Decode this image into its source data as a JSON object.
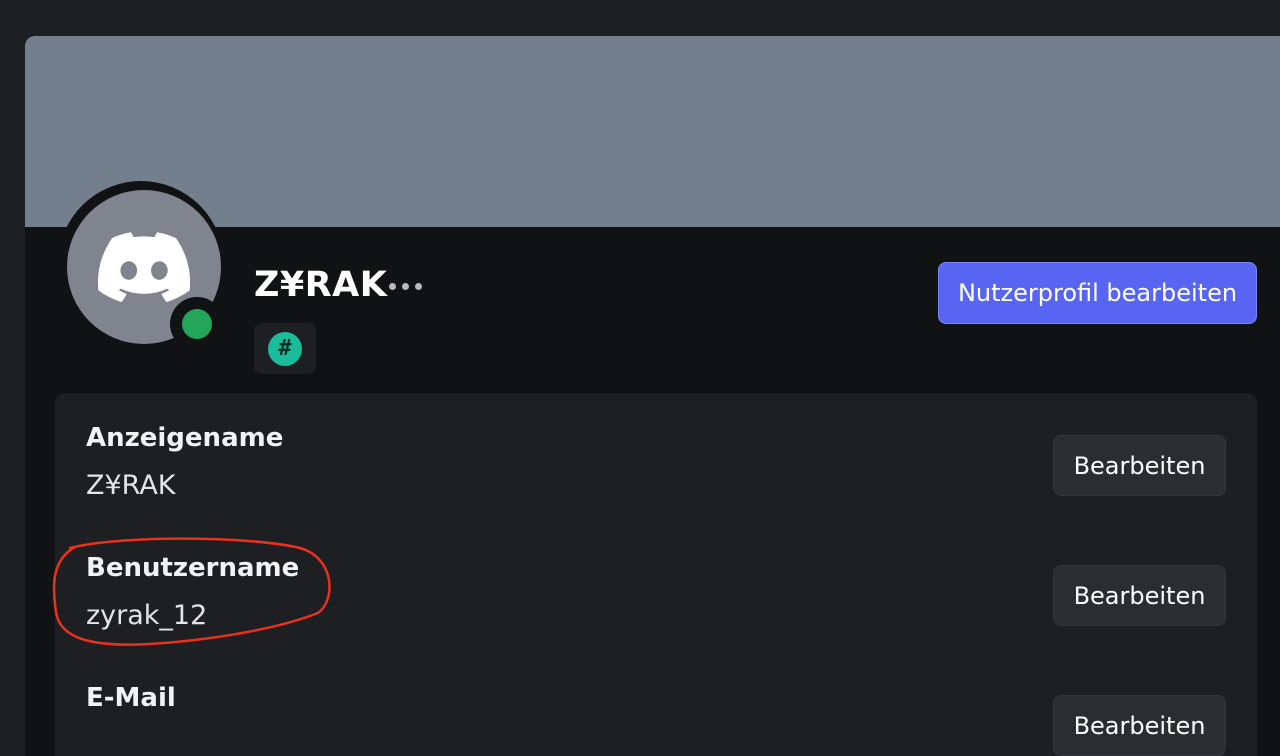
{
  "profile": {
    "display_name": "Z¥RAK",
    "badge_symbol": "#",
    "edit_profile_label": "Nutzerprofil bearbeiten"
  },
  "colors": {
    "banner": "#747f8d",
    "accent": "#5865f2",
    "status_online": "#23a55a",
    "badge": "#1abc9c"
  },
  "fields": [
    {
      "label": "Anzeigename",
      "value": "Z¥RAK",
      "action": "Bearbeiten"
    },
    {
      "label": "Benutzername",
      "value": "zyrak_12",
      "action": "Bearbeiten"
    },
    {
      "label": "E-Mail",
      "value": "",
      "action": "Bearbeiten"
    }
  ]
}
